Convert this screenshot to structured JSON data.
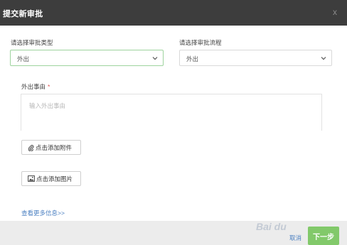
{
  "dialog": {
    "title": "提交新审批",
    "close_label": "x"
  },
  "approval_type": {
    "label": "请选择审批类型",
    "value": "外出"
  },
  "approval_flow": {
    "label": "请选择审批流程",
    "value": "外出"
  },
  "reason": {
    "label": "外出事由",
    "required_mark": "*",
    "placeholder": "输入外出事由"
  },
  "attachments": {
    "add_file_label": "点击添加附件",
    "add_image_label": "点击添加图片"
  },
  "more_info_link": "查看更多信息>>",
  "footer": {
    "cancel_label": "取消",
    "next_label": "下一步",
    "next_color": "#82c96a"
  },
  "colors": {
    "header_bg": "#3d3d3d",
    "link": "#4a7fc1",
    "required": "#e05555",
    "focus_border": "#9ed39e"
  }
}
